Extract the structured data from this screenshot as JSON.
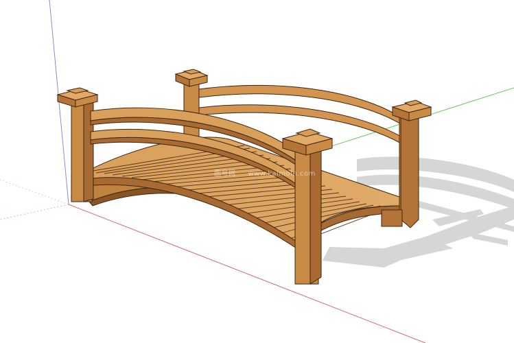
{
  "canvas": {
    "background": "#ffffff"
  },
  "model": {
    "subject": "wooden arched garden bridge"
  },
  "watermark": {
    "brand": "图号网",
    "site": "www.kaimoin.com"
  },
  "colors": {
    "wood_top": "#d79a55",
    "wood_side": "#b47437",
    "wood_dark": "#8a5424",
    "edge": "#3b2510",
    "shadow": "#d7d7d7",
    "axis_red": "#d06a6a",
    "axis_green": "#6cc46c",
    "axis_blue": "#8a8ad6"
  }
}
